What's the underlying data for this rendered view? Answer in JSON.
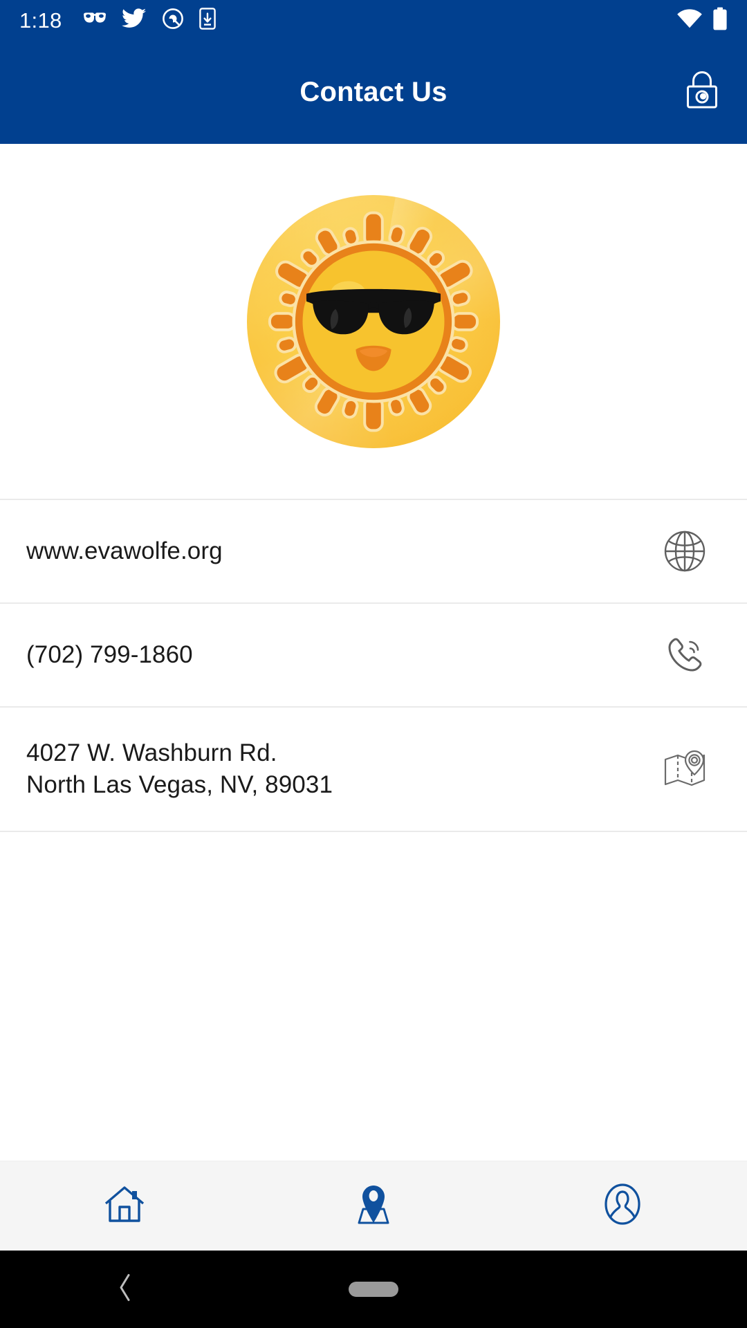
{
  "status_bar": {
    "time": "1:18",
    "left_icons": [
      "sunglasses-icon",
      "twitter-icon",
      "circle-slash-icon",
      "phone-download-icon"
    ],
    "right_icons": [
      "wifi-icon",
      "battery-icon"
    ]
  },
  "app_bar": {
    "title": "Contact Us",
    "action_icon": "lock-icon",
    "background_color": "#01408F",
    "title_color": "#FFFFFF"
  },
  "logo": {
    "name": "sun-with-sunglasses-logo",
    "background_color": "#FBCE4A",
    "sun_color": "#E8821A",
    "face_color": "#F7C32E",
    "glasses_color": "#111111"
  },
  "contact_rows": [
    {
      "name": "website-row",
      "line1": "www.evawolfe.org",
      "line2": "",
      "icon": "globe-icon"
    },
    {
      "name": "phone-row",
      "line1": "(702) 799-1860",
      "line2": "",
      "icon": "phone-call-icon"
    },
    {
      "name": "address-row",
      "line1": "4027 W. Washburn Rd.",
      "line2": "North Las Vegas,  NV,  89031",
      "icon": "map-pin-icon"
    }
  ],
  "bottom_nav": {
    "accent_color": "#10519E",
    "items": [
      {
        "name": "nav-home",
        "icon": "home-icon"
      },
      {
        "name": "nav-map",
        "icon": "map-location-icon"
      },
      {
        "name": "nav-profile",
        "icon": "person-icon"
      }
    ]
  },
  "android_nav": {
    "back": "back-chevron-icon",
    "home": "home-pill-indicator"
  }
}
